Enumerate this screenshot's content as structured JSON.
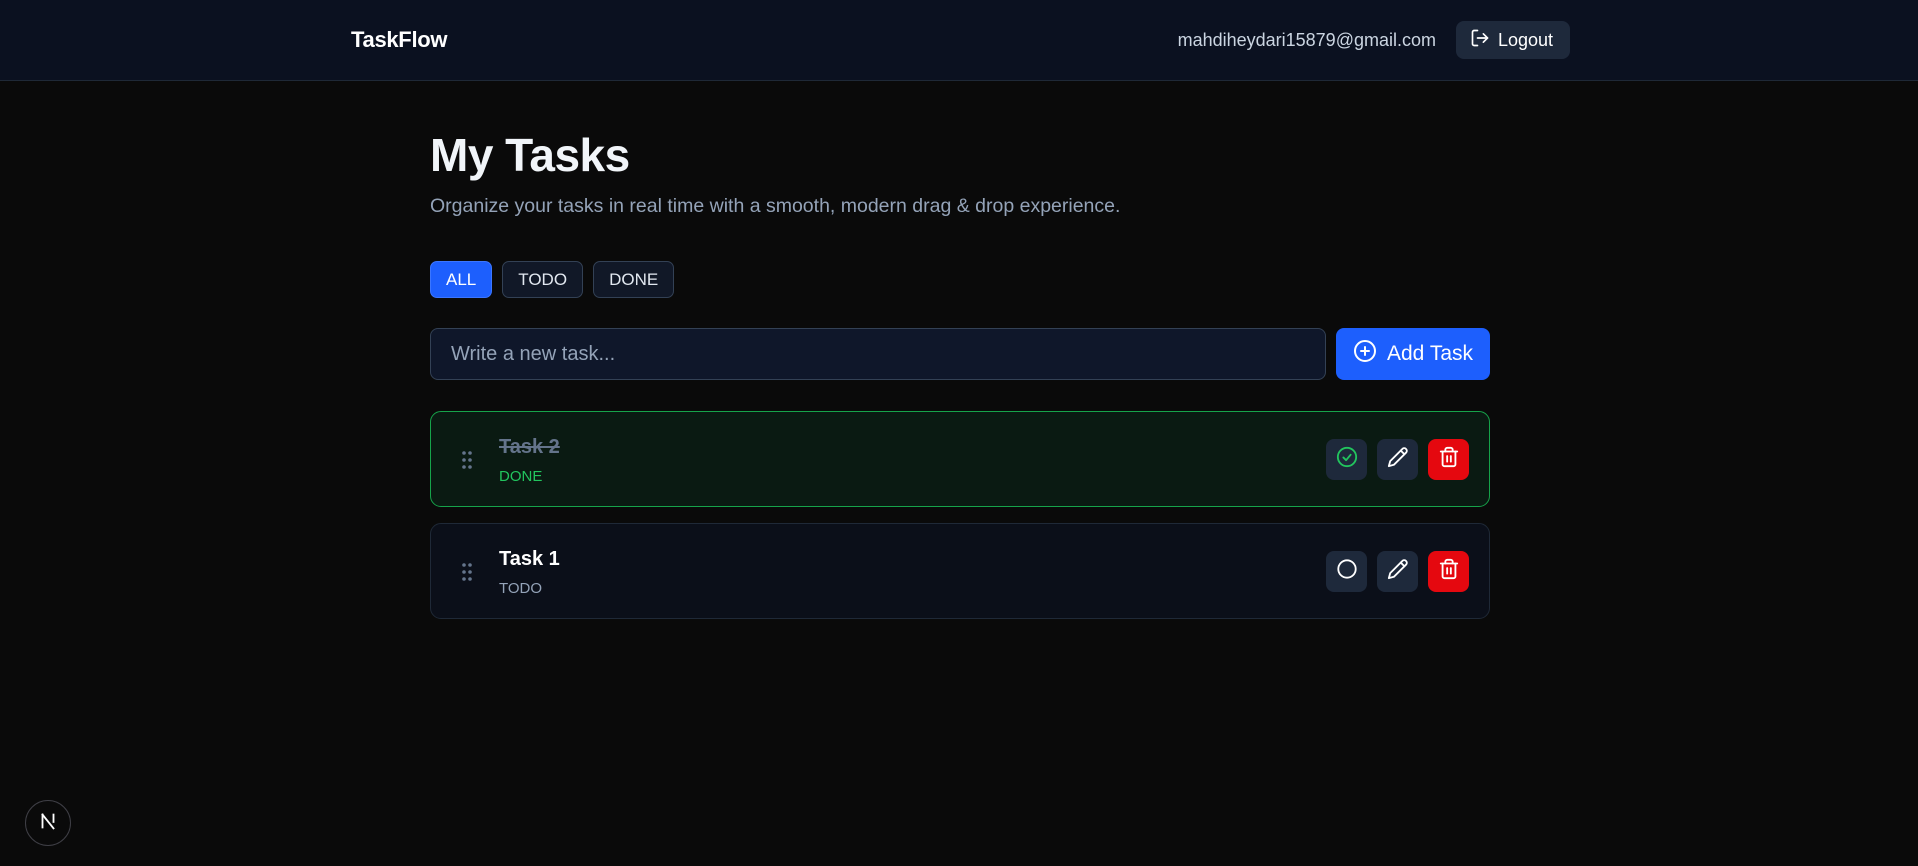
{
  "header": {
    "brand": "TaskFlow",
    "user_email": "mahdiheydari15879@gmail.com",
    "logout_label": "Logout"
  },
  "main": {
    "title": "My Tasks",
    "subtitle": "Organize your tasks in real time with a smooth, modern drag & drop experience."
  },
  "filters": [
    {
      "label": "ALL",
      "active": true
    },
    {
      "label": "TODO",
      "active": false
    },
    {
      "label": "DONE",
      "active": false
    }
  ],
  "new_task": {
    "placeholder": "Write a new task...",
    "value": "",
    "add_label": "Add Task"
  },
  "tasks": [
    {
      "title": "Task 2",
      "status": "DONE",
      "completed": true
    },
    {
      "title": "Task 1",
      "status": "TODO",
      "completed": false
    }
  ],
  "colors": {
    "accent": "#1d5ffd",
    "done": "#22c55e",
    "danger": "#e5080f",
    "background": "#0a0a0a"
  },
  "icons": {
    "logout": "logout-icon",
    "add": "plus-circle-icon",
    "drag": "drag-handle-icon",
    "complete": "check-circle-icon",
    "incomplete": "circle-icon",
    "edit": "pencil-icon",
    "delete": "trash-icon",
    "dev_badge": "nextjs-icon"
  }
}
